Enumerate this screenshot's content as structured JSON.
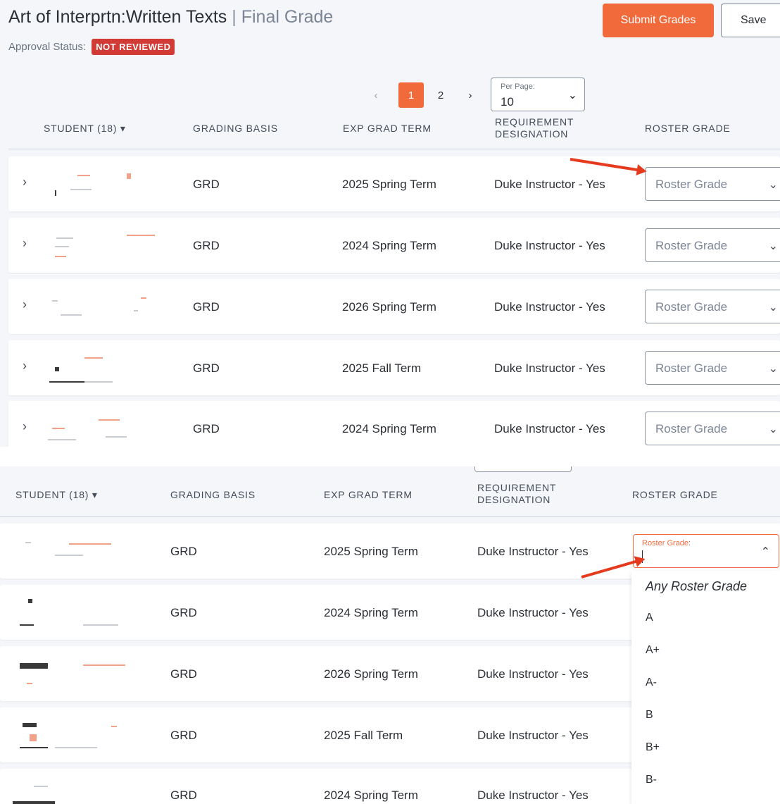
{
  "page": {
    "title": "Art of Interprtn:Written Texts",
    "separator": "|",
    "subtitle": "Final Grade",
    "approval_label": "Approval Status:",
    "approval_status": "NOT REVIEWED",
    "accent_color": "#f06a3c",
    "badge_color": "#d23a35"
  },
  "toolbar": {
    "submit_label": "Submit Grades",
    "save_label": "Save"
  },
  "pagination": {
    "prev_icon": "chevron-left-icon",
    "next_icon": "chevron-right-icon",
    "pages": [
      "1",
      "2"
    ],
    "current_page": "1",
    "per_page_label": "Per Page:",
    "per_page_value": "10"
  },
  "table": {
    "headers": {
      "student": "STUDENT (18) ▾",
      "grading_basis": "GRADING BASIS",
      "exp_grad_term": "EXP GRAD TERM",
      "requirement": "REQUIREMENT DESIGNATION",
      "roster_grade": "ROSTER GRADE"
    },
    "rows": [
      {
        "grading_basis": "GRD",
        "exp_grad_term": "2025 Spring Term",
        "requirement": "Duke Instructor - Yes",
        "roster_grade_placeholder": "Roster Grade"
      },
      {
        "grading_basis": "GRD",
        "exp_grad_term": "2024 Spring Term",
        "requirement": "Duke Instructor - Yes",
        "roster_grade_placeholder": "Roster Grade"
      },
      {
        "grading_basis": "GRD",
        "exp_grad_term": "2026 Spring Term",
        "requirement": "Duke Instructor - Yes",
        "roster_grade_placeholder": "Roster Grade"
      },
      {
        "grading_basis": "GRD",
        "exp_grad_term": "2025 Fall Term",
        "requirement": "Duke Instructor - Yes",
        "roster_grade_placeholder": "Roster Grade"
      },
      {
        "grading_basis": "GRD",
        "exp_grad_term": "2024 Spring Term",
        "requirement": "Duke Instructor - Yes",
        "roster_grade_placeholder": "Roster Grade"
      }
    ]
  },
  "open_dropdown": {
    "label": "Roster Grade:",
    "options": [
      "Any Roster Grade",
      "A",
      "A+",
      "A-",
      "B",
      "B+",
      "B-"
    ]
  }
}
